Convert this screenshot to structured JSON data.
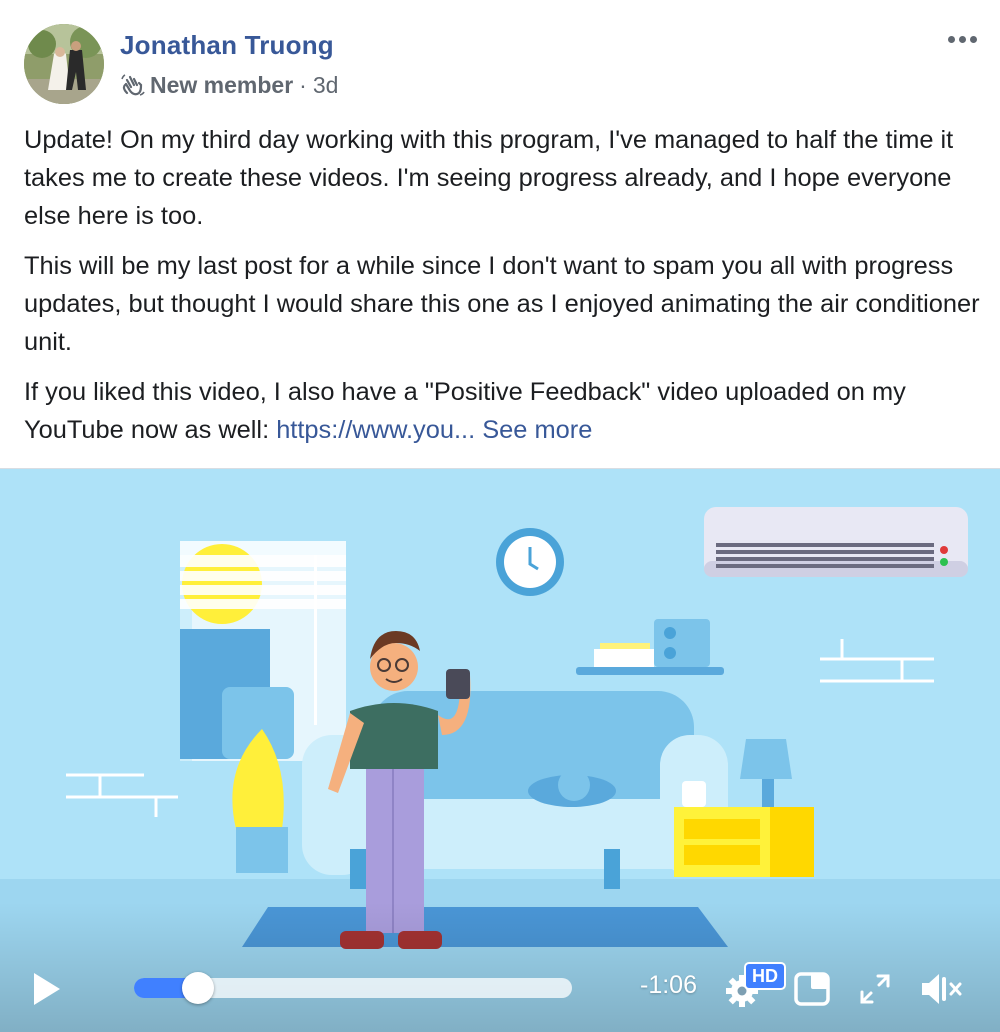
{
  "post": {
    "author_name": "Jonathan Truong",
    "badge": "New member",
    "separator": "·",
    "time": "3d",
    "paragraphs": [
      "Update! On my third day working with this program, I've managed to half the time it takes me to create these videos. I'm seeing progress already, and I hope everyone else here is too.",
      "This will be my last post for a while since I don't want to spam you all with progress updates, but thought I would share this one as I enjoyed animating the air conditioner unit."
    ],
    "last_paragraph_text": "If you liked this video, I also have a \"Positive Feedback\" video uploaded on my YouTube now as well: ",
    "link_text": "https://www.you...",
    "see_more": "See more",
    "icons": {
      "more": "more-options-icon",
      "badge": "wave-hand-icon"
    }
  },
  "video": {
    "time_remaining": "-1:06",
    "quality_badge": "HD",
    "progress_fraction": 0.11,
    "icons": [
      "play-icon",
      "settings-gear-icon",
      "picture-in-picture-icon",
      "fullscreen-icon",
      "volume-muted-icon"
    ],
    "colors": {
      "accent": "#4080ff",
      "link": "#385898",
      "background": "#aee2f8"
    }
  }
}
